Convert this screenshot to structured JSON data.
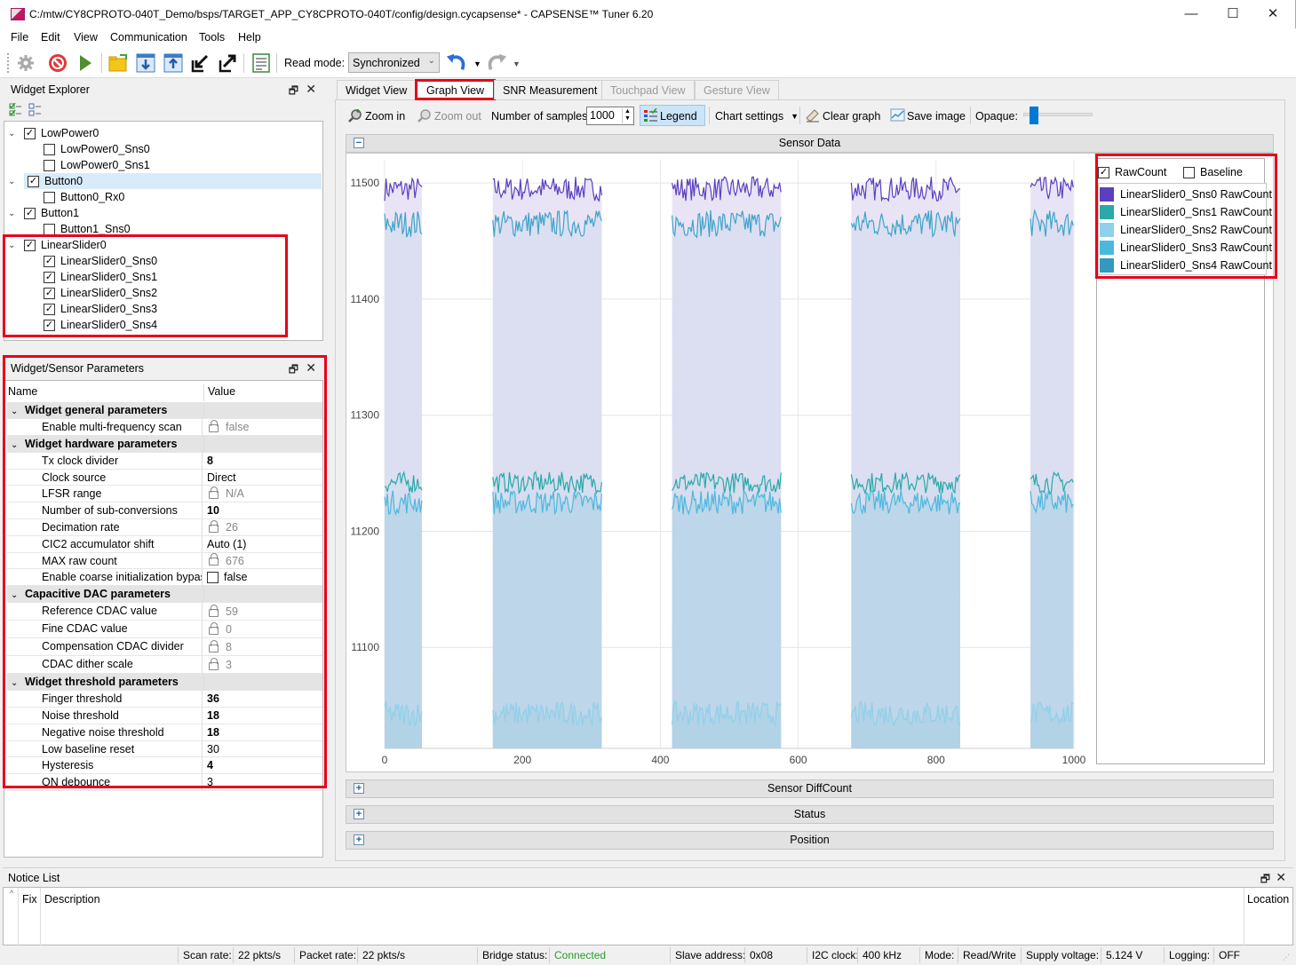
{
  "window": {
    "title": "C:/mtw/CY8CPROTO-040T_Demo/bsps/TARGET_APP_CY8CPROTO-040T/config/design.cycapsense* - CAPSENSE™ Tuner 6.20",
    "minimize": "—",
    "maximize": "☐",
    "close": "✕"
  },
  "menu": [
    "File",
    "Edit",
    "View",
    "Communication",
    "Tools",
    "Help"
  ],
  "toolbar": {
    "icons": [
      "gear-icon",
      "disconnect-icon",
      "start-icon",
      "open-folder-icon",
      "read-from-device-icon",
      "write-to-device-icon",
      "import-icon",
      "export-icon",
      "log-icon"
    ],
    "read_mode_label": "Read mode:",
    "read_mode_value": "Synchronized",
    "undo_icon": "undo-icon",
    "redo_icon": "redo-icon"
  },
  "widget_explorer": {
    "title": "Widget Explorer",
    "tree": [
      {
        "label": "LowPower0",
        "checked": true,
        "level": 0
      },
      {
        "label": "LowPower0_Sns0",
        "checked": false,
        "level": 1
      },
      {
        "label": "LowPower0_Sns1",
        "checked": false,
        "level": 1
      },
      {
        "label": "Button0",
        "checked": true,
        "level": 0,
        "selected": true
      },
      {
        "label": "Button0_Rx0",
        "checked": false,
        "level": 1
      },
      {
        "label": "Button1",
        "checked": true,
        "level": 0
      },
      {
        "label": "Button1_Sns0",
        "checked": false,
        "level": 1
      },
      {
        "label": "LinearSlider0",
        "checked": true,
        "level": 0
      },
      {
        "label": "LinearSlider0_Sns0",
        "checked": true,
        "level": 1
      },
      {
        "label": "LinearSlider0_Sns1",
        "checked": true,
        "level": 1
      },
      {
        "label": "LinearSlider0_Sns2",
        "checked": true,
        "level": 1
      },
      {
        "label": "LinearSlider0_Sns3",
        "checked": true,
        "level": 1
      },
      {
        "label": "LinearSlider0_Sns4",
        "checked": true,
        "level": 1
      }
    ]
  },
  "params": {
    "title": "Widget/Sensor Parameters",
    "col_name": "Name",
    "col_value": "Value",
    "rows": [
      {
        "type": "group",
        "name": "Widget general parameters"
      },
      {
        "name": "Enable multi-frequency scan",
        "value": "false",
        "locked": true,
        "style": "dis"
      },
      {
        "type": "group",
        "name": "Widget hardware parameters"
      },
      {
        "name": "Tx clock divider",
        "value": "8",
        "style": "bold"
      },
      {
        "name": "Clock source",
        "value": "Direct",
        "style": ""
      },
      {
        "name": "LFSR range",
        "value": "N/A",
        "locked": true,
        "style": "dis"
      },
      {
        "name": "Number of sub-conversions",
        "value": "10",
        "style": "bold"
      },
      {
        "name": "Decimation rate",
        "value": "26",
        "locked": true,
        "style": "dis"
      },
      {
        "name": "CIC2 accumulator shift",
        "value": "Auto (1)",
        "style": ""
      },
      {
        "name": "MAX raw count",
        "value": "676",
        "locked": true,
        "style": "dis"
      },
      {
        "name": "Enable coarse initialization bypass",
        "value": "false",
        "checkbox": true,
        "style": ""
      },
      {
        "type": "group",
        "name": "Capacitive DAC parameters"
      },
      {
        "name": "Reference CDAC value",
        "value": "59",
        "locked": true,
        "style": "dis"
      },
      {
        "name": "Fine CDAC value",
        "value": "0",
        "locked": true,
        "style": "dis"
      },
      {
        "name": "Compensation CDAC divider",
        "value": "8",
        "locked": true,
        "style": "dis"
      },
      {
        "name": "CDAC dither scale",
        "value": "3",
        "locked": true,
        "style": "dis"
      },
      {
        "type": "group",
        "name": "Widget threshold parameters"
      },
      {
        "name": "Finger threshold",
        "value": "36",
        "style": "bold"
      },
      {
        "name": "Noise threshold",
        "value": "18",
        "style": "bold"
      },
      {
        "name": "Negative noise threshold",
        "value": "18",
        "style": "bold"
      },
      {
        "name": "Low baseline reset",
        "value": "30",
        "style": ""
      },
      {
        "name": "Hysteresis",
        "value": "4",
        "style": "bold"
      },
      {
        "name": "ON debounce",
        "value": "3",
        "style": ""
      }
    ]
  },
  "tabs": [
    {
      "label": "Widget View",
      "state": "normal"
    },
    {
      "label": "Graph View",
      "state": "active"
    },
    {
      "label": "SNR Measurement",
      "state": "normal"
    },
    {
      "label": "Touchpad View",
      "state": "disabled"
    },
    {
      "label": "Gesture View",
      "state": "disabled"
    }
  ],
  "graph_toolbar": {
    "zoom_in": "Zoom in",
    "zoom_out": "Zoom out",
    "samples_label": "Number of samples:",
    "samples_value": "1000",
    "legend": "Legend",
    "chart_settings": "Chart settings",
    "clear_graph": "Clear graph",
    "save_image": "Save image",
    "opaque_label": "Opaque:",
    "opaque_level": 0.1
  },
  "sections": {
    "sensor_data": "Sensor Data",
    "diffcount": "Sensor DiffCount",
    "status": "Status",
    "position": "Position",
    "expand": "+",
    "collapse": "−"
  },
  "legend": {
    "rawcount_label": "RawCount",
    "rawcount_checked": true,
    "baseline_label": "Baseline",
    "baseline_checked": false,
    "items": [
      {
        "label": "LinearSlider0_Sns0 RawCount",
        "color": "#5b3fbf"
      },
      {
        "label": "LinearSlider0_Sns1 RawCount",
        "color": "#2ba8a8"
      },
      {
        "label": "LinearSlider0_Sns2 RawCount",
        "color": "#8fd0ea"
      },
      {
        "label": "LinearSlider0_Sns3 RawCount",
        "color": "#4cb8de"
      },
      {
        "label": "LinearSlider0_Sns4 RawCount",
        "color": "#3399c0"
      }
    ]
  },
  "chart_data": {
    "type": "area",
    "title": "Sensor Data",
    "xlabel": "",
    "ylabel": "",
    "xlim": [
      0,
      1000
    ],
    "ylim": [
      11013,
      11520
    ],
    "xticks": [
      0,
      200,
      400,
      600,
      800,
      1000
    ],
    "yticks": [
      11100,
      11200,
      11300,
      11400,
      11500
    ],
    "grid": true,
    "legend_position": "right",
    "visible_segments": [
      [
        0,
        55
      ],
      [
        157,
        316
      ],
      [
        417,
        576
      ],
      [
        677,
        836
      ],
      [
        937,
        1000
      ]
    ],
    "series": [
      {
        "name": "LinearSlider0_Sns0 RawCount",
        "color": "#5b3fbf",
        "mean": 11495,
        "noise": 8
      },
      {
        "name": "LinearSlider0_Sns4 RawCount",
        "color": "#3ea3c9",
        "mean": 11465,
        "noise": 9
      },
      {
        "name": "LinearSlider0_Sns1 RawCount",
        "color": "#2ba8a8",
        "mean": 11242,
        "noise": 7
      },
      {
        "name": "LinearSlider0_Sns3 RawCount",
        "color": "#4cb8de",
        "mean": 11225,
        "noise": 8
      },
      {
        "name": "LinearSlider0_Sns2 RawCount",
        "color": "#8fd0ea",
        "mean": 11043,
        "noise": 8
      }
    ]
  },
  "notice_list": {
    "title": "Notice List",
    "col_fix": "Fix",
    "col_description": "Description",
    "col_location": "Location"
  },
  "statusbar": {
    "scan_rate_label": "Scan rate:",
    "scan_rate": "22 pkts/s",
    "packet_rate_label": "Packet rate:",
    "packet_rate": "22 pkts/s",
    "bridge_label": "Bridge status:",
    "bridge": "Connected",
    "slave_label": "Slave address:",
    "slave": "0x08",
    "i2c_label": "I2C clock:",
    "i2c": "400 kHz",
    "mode_label": "Mode:",
    "mode": "Read/Write",
    "supply_label": "Supply voltage:",
    "supply": "5.124 V",
    "logging_label": "Logging:",
    "logging": "OFF"
  }
}
